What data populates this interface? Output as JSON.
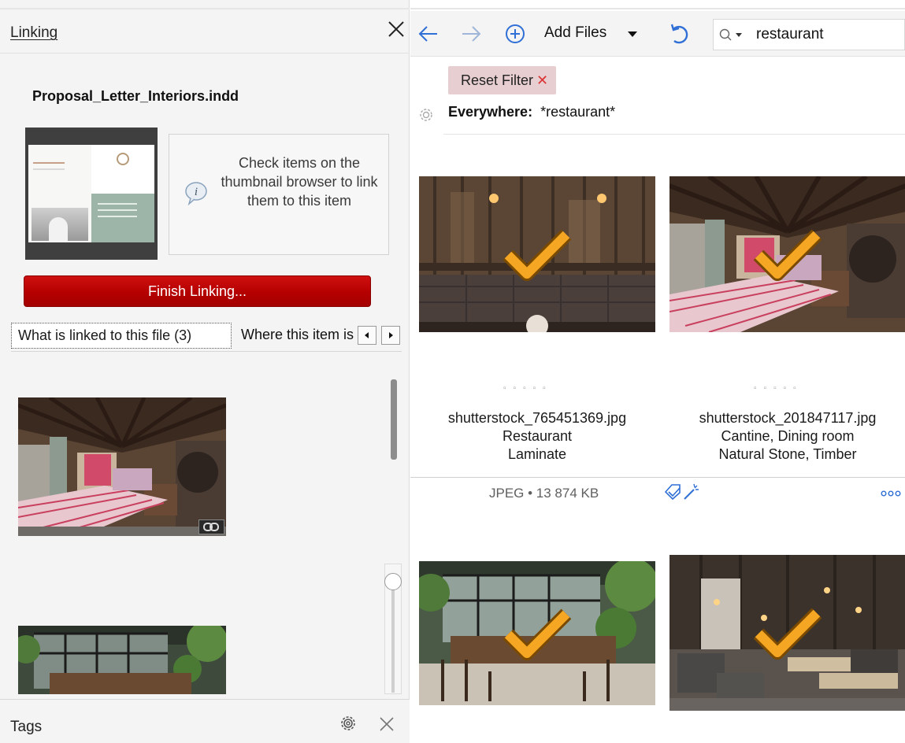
{
  "linking_panel": {
    "title": "Linking",
    "file_name": "Proposal_Letter_Interiors.indd",
    "info_text": "Check items on the thumbnail browser to link them to this item",
    "finish_button": "Finish Linking...",
    "tabs": [
      {
        "label": "What is linked to this file (3)",
        "selected": true
      },
      {
        "label": "Where this item is used",
        "selected": false
      }
    ]
  },
  "tags_panel": {
    "title": "Tags"
  },
  "toolbar": {
    "add_files_label": "Add Files",
    "search_value": "restaurant"
  },
  "filter": {
    "reset_label": "Reset Filter",
    "scope_label": "Everywhere:",
    "query": "*restaurant*"
  },
  "items": [
    {
      "filename": "shutterstock_765451369.jpg",
      "line2": "Restaurant",
      "line3": "Laminate",
      "checked": true
    },
    {
      "filename": "shutterstock_201847117.jpg",
      "line2": "Cantine, Dining room",
      "line3": "Natural Stone, Timber",
      "checked": true
    },
    {
      "checked": true
    },
    {
      "checked": true
    }
  ],
  "selected_meta": {
    "text": "JPEG • 13 874 KB"
  },
  "colors": {
    "accent_red": "#b50000",
    "check_orange": "#f5a623",
    "reset_chip": "#e6ced1",
    "toolbar_blue": "#2f6fd6"
  },
  "icons": {
    "back": "arrow-left-icon",
    "forward": "arrow-right-icon",
    "add": "plus-circle-icon",
    "refresh": "undo-icon",
    "search": "search-icon",
    "info": "info-bubble-icon",
    "tags_settings": "gear-icon",
    "close": "close-icon",
    "link_badge": "link-icon",
    "edit_tags": "tag-edit-icon",
    "auto_tag": "magic-wand-icon",
    "more": "more-dots-icon"
  }
}
